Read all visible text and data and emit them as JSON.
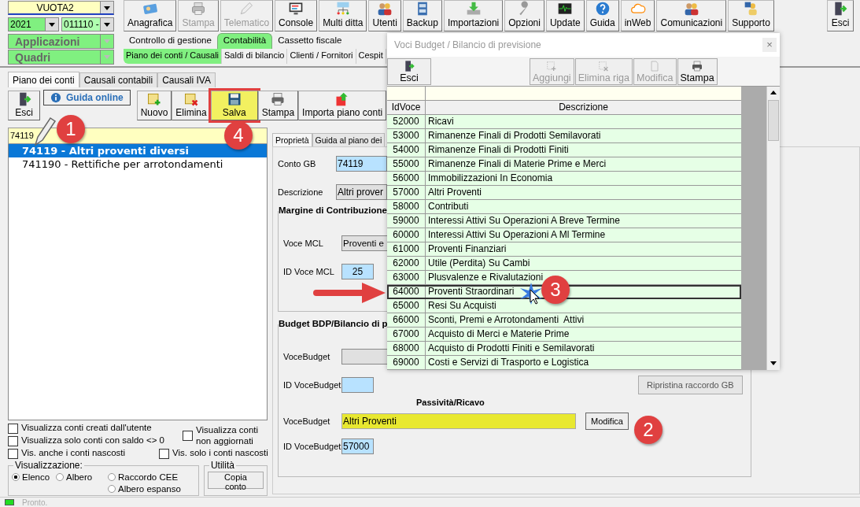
{
  "selectors": {
    "company": "VUOTA2",
    "year": "2021",
    "code": "011110 -",
    "applications": "Applicazioni",
    "forms": "Quadri"
  },
  "toolbar": [
    {
      "label": "Anagrafica",
      "disabled": false
    },
    {
      "label": "Stampa",
      "disabled": true
    },
    {
      "label": "Telematico",
      "disabled": true
    },
    {
      "label": "Console",
      "disabled": false
    },
    {
      "label": "Multi ditta",
      "disabled": false
    },
    {
      "label": "Utenti",
      "disabled": false
    },
    {
      "label": "Backup",
      "disabled": false
    },
    {
      "label": "Importazioni",
      "disabled": false
    },
    {
      "label": "Opzioni",
      "disabled": false
    },
    {
      "label": "Update",
      "disabled": false
    },
    {
      "label": "Guida",
      "disabled": false
    },
    {
      "label": "inWeb",
      "disabled": false
    },
    {
      "label": "Comunicazioni",
      "disabled": false
    },
    {
      "label": "Supporto",
      "disabled": false
    }
  ],
  "exit_button": "Esci",
  "module_tabs": [
    {
      "label": "Controllo di gestione",
      "selected": false
    },
    {
      "label": "Contabilità",
      "selected": true
    },
    {
      "label": "Cassetto fiscale",
      "selected": false
    }
  ],
  "section_tabs": [
    {
      "label": "Piano dei conti / Causali",
      "selected": true
    },
    {
      "label": "Saldi di bilancio",
      "selected": false
    },
    {
      "label": "Clienti / Fornitori",
      "selected": false
    },
    {
      "label": "Cespit",
      "selected": false
    }
  ],
  "page_tabs": [
    {
      "label": "Piano dei conti",
      "selected": true
    },
    {
      "label": "Causali contabili",
      "selected": false
    },
    {
      "label": "Causali IVA",
      "selected": false
    }
  ],
  "exit": "Esci",
  "guide_link": "Guida online",
  "actions": [
    {
      "label": "Nuovo",
      "highlighted": false
    },
    {
      "label": "Elimina",
      "highlighted": false
    },
    {
      "label": "Salva",
      "highlighted": true
    },
    {
      "label": "Stampa",
      "highlighted": false
    },
    {
      "label": "Importa piano conti",
      "highlighted": false
    }
  ],
  "search": "74119",
  "accounts": [
    {
      "label": "74119 - Altri proventi diversi",
      "selected": true
    },
    {
      "label": "741190 - Rettifiche per arrotondamenti",
      "selected": false
    }
  ],
  "filters_left": [
    {
      "label": "Visualizza conti creati dall'utente",
      "checked": false
    },
    {
      "label": "Visualizza solo conti con saldo <> 0",
      "checked": false
    },
    {
      "label": "Vis. anche i conti nascosti",
      "checked": false
    }
  ],
  "filters_right": [
    {
      "label": "Visualizza conti non aggiornati",
      "checked": false
    },
    {
      "label": "Vis. solo i conti nascosti",
      "checked": false
    }
  ],
  "view": {
    "title": "Visualizzazione:",
    "options": [
      {
        "label": "Elenco",
        "selected": true
      },
      {
        "label": "Albero",
        "selected": false
      },
      {
        "label": "Raccordo CEE",
        "selected": false
      },
      {
        "label": "Albero espanso",
        "selected": false
      }
    ]
  },
  "utility": {
    "title": "Utilità",
    "button": "Copia conto"
  },
  "detail_tabs": [
    {
      "label": "Proprietà",
      "selected": true
    },
    {
      "label": "Guida al piano dei",
      "selected": false
    }
  ],
  "account": {
    "code_label": "Conto GB",
    "code": "74119",
    "desc_label": "Descrizione",
    "desc": "Altri prover"
  },
  "margin": {
    "title": "Margine di Contribuzione",
    "item_label": "Voce MCL",
    "item": "Proventi e",
    "id_label": "ID Voce MCL",
    "id": "25"
  },
  "budget": {
    "title": "Budget BDP/Bilancio di p",
    "item_label": "VoceBudget",
    "id_label": "ID VoceBudget",
    "restore": "Ripristina raccordo GB",
    "section": "Passività/Ricavo",
    "new_item_label": "VoceBudget",
    "new_item": "Altri Proventi",
    "edit": "Modifica",
    "new_id_label": "ID VoceBudget",
    "new_id": "57000"
  },
  "dialog": {
    "title": "Voci Budget / Bilancio di previsione",
    "close": "×",
    "buttons": [
      {
        "label": "Esci",
        "disabled": false
      },
      {
        "label": "Aggiungi",
        "disabled": true
      },
      {
        "label": "Elimina riga",
        "disabled": true
      },
      {
        "label": "Modifica",
        "disabled": true
      },
      {
        "label": "Stampa",
        "disabled": false
      }
    ],
    "columns": [
      "IdVoce",
      "Descrizione"
    ],
    "rows": [
      {
        "id": "52000",
        "desc": "Ricavi",
        "selected": false
      },
      {
        "id": "53000",
        "desc": "Rimanenze Finali di Prodotti Semilavorati",
        "selected": false
      },
      {
        "id": "54000",
        "desc": "Rimanenze Finali di Prodotti Finiti",
        "selected": false
      },
      {
        "id": "55000",
        "desc": "Rimanenze Finali di Materie Prime e Merci",
        "selected": false
      },
      {
        "id": "56000",
        "desc": "Immobilizzazioni In Economia",
        "selected": false
      },
      {
        "id": "57000",
        "desc": "Altri Proventi",
        "selected": false
      },
      {
        "id": "58000",
        "desc": "Contributi",
        "selected": false
      },
      {
        "id": "59000",
        "desc": "Interessi Attivi Su Operazioni A Breve Termine",
        "selected": false
      },
      {
        "id": "60000",
        "desc": "Interessi Attivi Su Operazioni A Ml Termine",
        "selected": false
      },
      {
        "id": "61000",
        "desc": "Proventi Finanziari",
        "selected": false
      },
      {
        "id": "62000",
        "desc": "Utile (Perdita) Su Cambi",
        "selected": false
      },
      {
        "id": "63000",
        "desc": "Plusvalenze e Rivalutazioni",
        "selected": false
      },
      {
        "id": "64000",
        "desc": "Proventi Straordinari",
        "selected": true
      },
      {
        "id": "65000",
        "desc": "Resi Su Acquisti",
        "selected": false
      },
      {
        "id": "66000",
        "desc": "Sconti, Premi e Arrotondamenti  Attivi",
        "selected": false
      },
      {
        "id": "67000",
        "desc": "Acquisto di Merci e Materie Prime",
        "selected": false
      },
      {
        "id": "68000",
        "desc": "Acquisto di Prodotti Finiti e Semilavorati",
        "selected": false
      },
      {
        "id": "69000",
        "desc": "Costi e Servizi di Trasporto e Logistica",
        "selected": false
      }
    ]
  },
  "callouts": [
    "1",
    "4",
    "3",
    "2"
  ],
  "status": "Pronto."
}
